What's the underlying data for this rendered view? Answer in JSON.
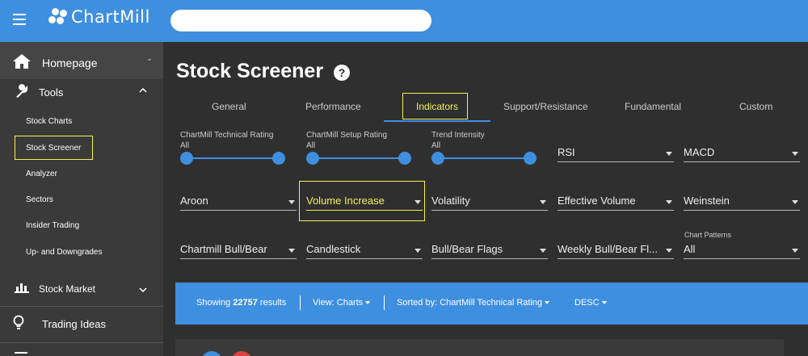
{
  "brand": {
    "logo_text": "ChartMill"
  },
  "search": {
    "placeholder": ""
  },
  "sidebar": {
    "homepage": "Homepage",
    "tools": "Tools",
    "tool_items": [
      "Stock Charts",
      "Stock Screener",
      "Analyzer",
      "Sectors",
      "Insider Trading",
      "Up- and Downgrades"
    ],
    "stock_market": "Stock Market",
    "trading_ideas": "Trading Ideas",
    "collapse_symbol": "-"
  },
  "page": {
    "title": "Stock Screener",
    "help_symbol": "?"
  },
  "tabs": [
    "General",
    "Performance",
    "Indicators",
    "Support/Resistance",
    "Fundamental",
    "Custom"
  ],
  "sliders": [
    {
      "label": "ChartMill Technical Rating",
      "value": "All"
    },
    {
      "label": "ChartMill Setup Rating",
      "value": "All"
    },
    {
      "label": "Trend Intensity",
      "value": "All"
    }
  ],
  "dropdowns": {
    "row1": [
      "RSI",
      "MACD"
    ],
    "row2": [
      "Aroon",
      "Volume Increase",
      "Volatility",
      "Effective Volume",
      "Weinstein"
    ],
    "row3": [
      "Chartmill Bull/Bear",
      "Candlestick",
      "Bull/Bear Flags",
      "Weekly Bull/Bear Fl..."
    ],
    "chart_patterns": {
      "label": "Chart Patterns",
      "value": "All"
    }
  },
  "results": {
    "showing_prefix": "Showing",
    "count": "22757",
    "showing_suffix": "results",
    "view": "View: Charts",
    "sorted_by": "Sorted by: ChartMill Technical Rating",
    "order": "DESC"
  },
  "colors": {
    "accent": "#3f8fe0",
    "highlight": "#f2f25a",
    "background": "#2f2f2f",
    "sidebar": "#3a3a3a"
  }
}
